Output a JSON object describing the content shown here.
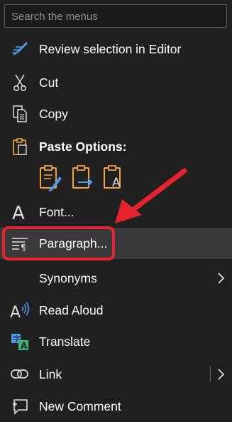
{
  "search": {
    "placeholder": "Search the menus"
  },
  "items": {
    "review": {
      "label": "Review selection in Editor",
      "icon": "editor-pen-icon"
    },
    "cut": {
      "label": "Cut",
      "icon": "scissors-icon"
    },
    "copy": {
      "label": "Copy",
      "icon": "copy-icon"
    },
    "paste_options": {
      "label": "Paste Options:",
      "icon": "clipboard-icon"
    },
    "font": {
      "label": "Font...",
      "icon": "font-icon"
    },
    "paragraph": {
      "label": "Paragraph...",
      "icon": "paragraph-icon"
    },
    "synonyms": {
      "label": "Synonyms"
    },
    "read_aloud": {
      "label": "Read Aloud",
      "icon": "read-aloud-icon"
    },
    "translate": {
      "label": "Translate",
      "icon": "translate-icon"
    },
    "link": {
      "label": "Link",
      "icon": "link-icon"
    },
    "new_comment": {
      "label": "New Comment",
      "icon": "comment-icon"
    }
  },
  "paste_buttons": [
    {
      "name": "keep-source-formatting",
      "icon": "paste-keep-formatting-icon"
    },
    {
      "name": "merge-formatting",
      "icon": "paste-merge-icon"
    },
    {
      "name": "keep-text-only",
      "icon": "paste-text-only-icon"
    }
  ],
  "colors": {
    "menu_bg": "#202020",
    "hover_bg": "#3a3a3a",
    "accent_blue": "#4a9cf0",
    "accent_orange": "#f0a43a",
    "annotation_red": "#e8232f"
  }
}
